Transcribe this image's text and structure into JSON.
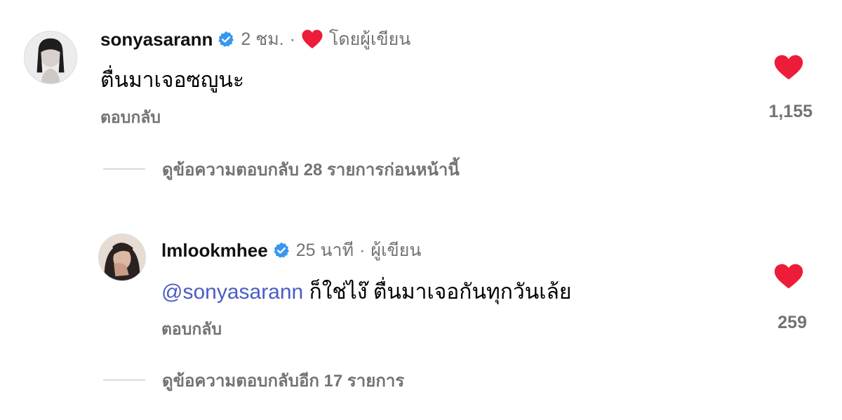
{
  "comments": [
    {
      "username": "sonyasarann",
      "verified_icon": "verified-badge-icon",
      "time": "2 ชม.",
      "separator": "·",
      "liked_by_author_icon": "heart-icon",
      "author_label": "โดยผู้เขียน",
      "text": "ตื่นมาเจอซญูนะ",
      "reply_label": "ตอบกลับ",
      "like_icon": "heart-filled-icon",
      "like_count": "1,155",
      "view_replies_label": "ดูข้อความตอบกลับ 28 รายการก่อนหน้านี้"
    },
    {
      "username": "lmlookmhee",
      "verified_icon": "verified-badge-icon",
      "time": "25 นาที",
      "separator": "·",
      "author_label": "ผู้เขียน",
      "mention": "@sonyasarann",
      "text": "ก็ใช่ไง๊ ตื่นมาเจอกันทุกวันเล้ย",
      "reply_label": "ตอบกลับ",
      "like_icon": "heart-filled-icon",
      "like_count": "259",
      "view_replies_label": "ดูข้อความตอบกลับอีก 17 รายการ"
    }
  ],
  "colors": {
    "heart": "#ed1c39",
    "verified": "#3897f0",
    "mention": "#4b5cc4",
    "meta": "#737373"
  }
}
